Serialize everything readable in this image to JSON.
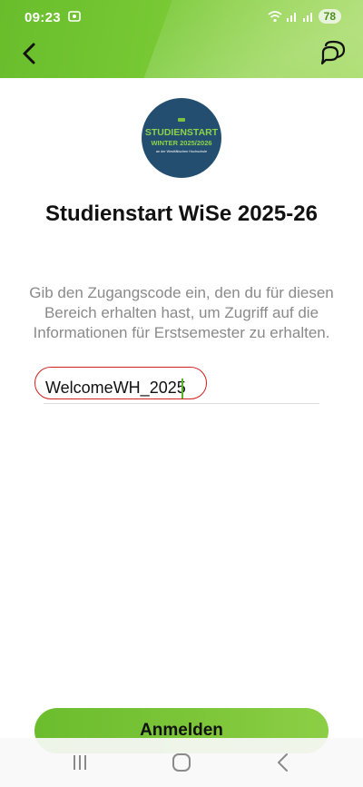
{
  "status_bar": {
    "time": "09:23",
    "battery": "78"
  },
  "header": {
    "back_icon": "chevron-left-icon",
    "chat_icon": "chat-bubbles-icon",
    "accent_color": "#78c934"
  },
  "logo": {
    "line1": "STUDIENSTART",
    "line2": "WINTER 2025/2026",
    "line3": "an der Westfälischen Hochschule"
  },
  "page": {
    "title": "Studienstart WiSe 2025-26",
    "description": "Gib den Zugangscode ein, den du für diesen Bereich erhalten hast, um Zugriff auf die Informationen für Erstsemester zu erhalten."
  },
  "access_code": {
    "value": "WelcomeWH_2025"
  },
  "actions": {
    "login_label": "Anmelden"
  },
  "nav": {
    "recents_icon": "recents-icon",
    "home_icon": "home-icon",
    "back_icon": "back-icon"
  }
}
